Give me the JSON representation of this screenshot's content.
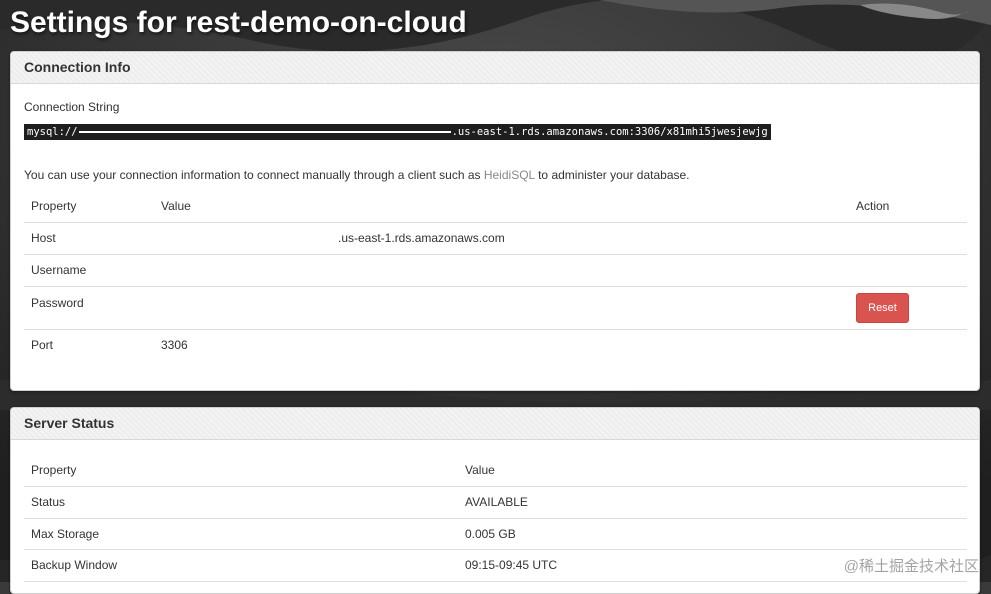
{
  "page": {
    "title": "Settings for rest-demo-on-cloud"
  },
  "connection_info": {
    "heading": "Connection Info",
    "connection_string_label": "Connection String",
    "connection_string_prefix": "mysql://",
    "connection_string_suffix": ".us-east-1.rds.amazonaws.com:3306/x81mhi5jwesjewjg",
    "note_before": "You can use your connection information to connect manually through a client such as ",
    "note_link": "HeidiSQL",
    "note_after": " to administer your database.",
    "table": {
      "headers": {
        "property": "Property",
        "value": "Value",
        "action": "Action"
      },
      "rows": [
        {
          "property": "Host",
          "value": ".us-east-1.rds.amazonaws.com"
        },
        {
          "property": "Username",
          "value": ""
        },
        {
          "property": "Password",
          "value": "",
          "action": "Reset"
        },
        {
          "property": "Port",
          "value": "3306"
        }
      ]
    }
  },
  "server_status": {
    "heading": "Server Status",
    "table": {
      "headers": {
        "property": "Property",
        "value": "Value"
      },
      "rows": [
        {
          "property": "Status",
          "value": "AVAILABLE"
        },
        {
          "property": "Max Storage",
          "value": "0.005 GB"
        },
        {
          "property": "Backup Window",
          "value": "09:15-09:45 UTC"
        }
      ]
    }
  },
  "watermark": "@稀土掘金技术社区",
  "colors": {
    "danger": "#d9534f",
    "link": "#888888",
    "code_bg": "#1e1e1e"
  }
}
